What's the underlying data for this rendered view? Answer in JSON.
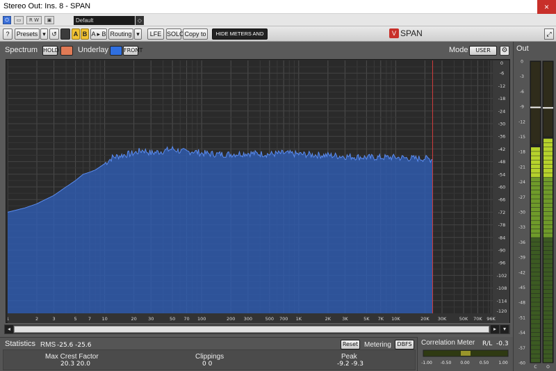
{
  "window": {
    "title": "Stereo Out: Ins. 8 - SPAN",
    "close_label": "×"
  },
  "host": {
    "buttons": [
      "⏻",
      "▭",
      "R W",
      "▣"
    ],
    "preset_value": "Default",
    "preset_arrow": "◇"
  },
  "toolbar": {
    "help": "?",
    "presets": "Presets",
    "presets_arrow": "▾",
    "undo": "↺",
    "a": "A",
    "b": "B",
    "a_to_b": "A ▸ B",
    "routing": "Routing",
    "routing_arrow": "▾",
    "lfe": "LFE",
    "solo": "SOLO",
    "copy_to": "Copy to",
    "hide_meters": "HIDE METERS AND STATS",
    "logo_badge": "V",
    "logo_text": "SPAN",
    "maximize": "⤢"
  },
  "spectrum_header": {
    "label": "Spectrum",
    "hold": "HOLD",
    "hold_color": "#e07a55",
    "underlay_label": "Underlay",
    "underlay_color": "#2f6fe0",
    "front": "FRONT",
    "mode_label": "Mode",
    "mode_value": "USER",
    "settings_icon": "⚙"
  },
  "chart_data": {
    "type": "area",
    "x_scale": "log",
    "xlim": [
      1,
      100000
    ],
    "ylim": [
      -120,
      0
    ],
    "x_ticks": [
      {
        "v": 1,
        "t": "1"
      },
      {
        "v": 2,
        "t": "2"
      },
      {
        "v": 3,
        "t": "3"
      },
      {
        "v": 5,
        "t": "5"
      },
      {
        "v": 7,
        "t": "7"
      },
      {
        "v": 10,
        "t": "10"
      },
      {
        "v": 20,
        "t": "20"
      },
      {
        "v": 30,
        "t": "30"
      },
      {
        "v": 50,
        "t": "50"
      },
      {
        "v": 70,
        "t": "70"
      },
      {
        "v": 100,
        "t": "100"
      },
      {
        "v": 200,
        "t": "200"
      },
      {
        "v": 300,
        "t": "300"
      },
      {
        "v": 500,
        "t": "500"
      },
      {
        "v": 700,
        "t": "700"
      },
      {
        "v": 1000,
        "t": "1K"
      },
      {
        "v": 2000,
        "t": "2K"
      },
      {
        "v": 3000,
        "t": "3K"
      },
      {
        "v": 5000,
        "t": "5K"
      },
      {
        "v": 7000,
        "t": "7K"
      },
      {
        "v": 10000,
        "t": "10K"
      },
      {
        "v": 20000,
        "t": "20K"
      },
      {
        "v": 30000,
        "t": "30K"
      },
      {
        "v": 50000,
        "t": "50K"
      },
      {
        "v": 70000,
        "t": "70K"
      },
      {
        "v": 96000,
        "t": "96K"
      }
    ],
    "y_ticks": [
      -6,
      -12,
      -18,
      -24,
      -30,
      -36,
      -42,
      -48,
      -54,
      -60,
      -66,
      -72,
      -78,
      -84,
      -90,
      -96,
      -102,
      -108,
      -114
    ],
    "y_tick_labels": [
      "-6",
      "-12",
      "-18",
      "-24",
      "-30",
      "-36",
      "-42",
      "-48",
      "-54",
      "-60",
      "-66",
      "-72",
      "-78",
      "-84",
      "-90",
      "-96",
      "-102",
      "-108",
      "-114"
    ],
    "y_top_label": "0",
    "y_bottom_label": "-120",
    "cutoff_hz": 24000,
    "series": [
      {
        "color": "#2f5fb8",
        "x": [
          1,
          1.5,
          2,
          3,
          4,
          5,
          6,
          7,
          8,
          10,
          12,
          15,
          20,
          25,
          30,
          40,
          50,
          60,
          70,
          80,
          100,
          150,
          200,
          300,
          500,
          700,
          1000,
          2000,
          3000,
          5000,
          7000,
          10000,
          15000,
          20000,
          24000
        ],
        "y": [
          -72,
          -70,
          -68,
          -64,
          -60,
          -57,
          -54,
          -53,
          -52,
          -49,
          -46,
          -45,
          -44,
          -42.5,
          -44,
          -43,
          -42,
          -43,
          -43.5,
          -43,
          -44,
          -44.5,
          -44.5,
          -44,
          -44.5,
          -44,
          -44.5,
          -45,
          -45.5,
          -46,
          -46,
          -46,
          -46.5,
          -46.5,
          -47
        ]
      }
    ]
  },
  "scrollbar": {
    "left": "◂",
    "right": "▸",
    "up": "▴",
    "down": "▾"
  },
  "statistics": {
    "label": "Statistics",
    "rms_label": "RMS",
    "rms_values": "-25.6  -25.6",
    "reset": "Reset",
    "metering_label": "Metering",
    "metering_value": "DBFS",
    "max_crest_label": "Max Crest Factor",
    "max_crest_values": "20.3  20.0",
    "clippings_label": "Clippings",
    "clippings_values": "0        0",
    "peak_label": "Peak",
    "peak_values": "-9.2  -9.3"
  },
  "correlation": {
    "label": "Correlation Meter",
    "rl_label": "R/L",
    "rl_value": "-0.3",
    "value": 0.0,
    "scale": [
      "-1.00",
      "-0.50",
      "0.00",
      "0.50",
      "1.00"
    ]
  },
  "out_meter": {
    "label": "Out",
    "scale": [
      "0",
      "-3",
      "-6",
      "-9",
      "-12",
      "-15",
      "-18",
      "-21",
      "-24",
      "-27",
      "-30",
      "-33",
      "-36",
      "-39",
      "-42",
      "-45",
      "-48",
      "-51",
      "-54",
      "-57",
      "-60"
    ],
    "channel_labels": [
      "C",
      "O"
    ],
    "rms_db": [
      -16.5,
      -15.0
    ],
    "peak_db": [
      -9.2,
      -9.3
    ]
  }
}
